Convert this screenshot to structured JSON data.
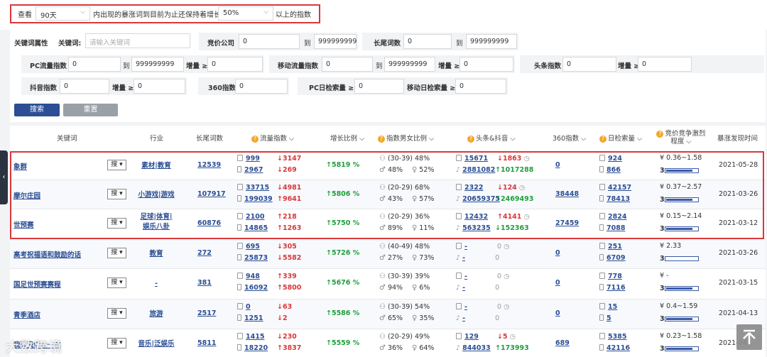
{
  "topbar": {
    "look_label": "查看",
    "period_value": "90天",
    "middle_text": "内出现的暴涨词到目前为止还保持着增长",
    "growth_value": "50%",
    "suffix_text": "以上的指数"
  },
  "filters": {
    "attr_label": "关键词属性",
    "keyword_label": "关键词:",
    "keyword_placeholder": "请输入关键词",
    "bid_company_label": "竞价公司",
    "longtail_label": "长尾词数",
    "pc_flow_label": "PC流量指数",
    "mobile_flow_label": "移动流量指数",
    "toutiao_label": "头条指数",
    "douyin_label": "抖音指数",
    "s360_label": "360指数",
    "pc_daily_label": "PC日检索量 ≥",
    "mobile_daily_label": "移动日检索量 ≥",
    "to": "到",
    "growth_ge": "增量 ≥",
    "zero": "0",
    "max": "999999999",
    "search_btn": "搜索",
    "reset_btn": "重置"
  },
  "table": {
    "headers": {
      "keyword": "关键词",
      "industry": "行业",
      "longtail": "长尾词数",
      "flow": "流量指数",
      "growth": "增长比例",
      "gender": "指数男女比例",
      "toutiao": "头条&抖音",
      "s360": "360指数",
      "daily": "日检索量",
      "bid": "竞价竞争激烈程度",
      "found": "暴涨发现时间"
    },
    "search_label": "搜",
    "rows": [
      {
        "kw": "象群",
        "industry": "素材|教育",
        "longtail": "12539",
        "pc": "999",
        "pc_d": "↓3147",
        "mob": "2967",
        "mob_d": "↓269",
        "growth": "↑5819 %",
        "age": "(30-39) 48%",
        "male": "48%",
        "female": "52%",
        "tt": "15671",
        "tt_d": "↓1863",
        "dy": "2881082",
        "dy_d": "↑1017288",
        "s360": "0",
        "daily_pc": "924",
        "daily_mob": "866",
        "bid_price": "¥ 0.36~1.58",
        "bid_level": "3",
        "bid_fill": 0.85,
        "date": "2021-05-28"
      },
      {
        "kw": "摩尔庄园",
        "industry": "小游戏|游戏",
        "longtail": "107917",
        "pc": "33715",
        "pc_d": "↓4981",
        "mob": "199039",
        "mob_d": "↑9641",
        "growth": "↑5806 %",
        "age": "(20-29) 68%",
        "male": "43%",
        "female": "57%",
        "tt": "2322",
        "tt_d": "↓124",
        "dy": "20659375",
        "dy_d": "↑2469493",
        "s360": "38448",
        "daily_pc": "42157",
        "daily_mob": "78413",
        "bid_price": "¥ 0.37~2.57",
        "bid_level": "3",
        "bid_fill": 0.85,
        "date": "2021-03-26"
      },
      {
        "kw": "世预赛",
        "industry": "足球|体育|",
        "industry2": "娱乐八卦",
        "longtail": "60876",
        "pc": "2100",
        "pc_d": "↑218",
        "mob": "14865",
        "mob_d": "↑1263",
        "growth": "↑5750 %",
        "age": "(20-29) 36%",
        "male": "89%",
        "female": "11%",
        "tt": "12432",
        "tt_d": "↑4141",
        "dy": "563235",
        "dy_d": "↓152363",
        "s360": "27459",
        "daily_pc": "2824",
        "daily_mob": "7088",
        "bid_price": "¥ 0.15~2.14",
        "bid_level": "3",
        "bid_fill": 0.85,
        "date": "2021-03-12"
      },
      {
        "kw": "高考祝福语和鼓励的话",
        "industry": "教育",
        "longtail": "272",
        "pc": "695",
        "pc_d": "↓305",
        "mob": "25873",
        "mob_d": "↓5582",
        "growth": "↑5726 %",
        "age": "(40-49) 48%",
        "male": "27%",
        "female": "73%",
        "tt": "-",
        "tt_d": "0",
        "dy": "-",
        "dy_d": "0",
        "s360": "0",
        "daily_pc": "251",
        "daily_mob": "6709",
        "bid_price": "¥ 2.33",
        "bid_level": "3",
        "bid_fill": 0.0,
        "date": "2021-03-26"
      },
      {
        "kw": "国足世预赛赛程",
        "industry": "-",
        "longtail": "381",
        "pc": "948",
        "pc_d": "↑339",
        "mob": "16092",
        "mob_d": "↑5800",
        "growth": "↑5676 %",
        "age": "(30-39) 39%",
        "male": "94%",
        "female": "6%",
        "tt": "-",
        "tt_d": "0",
        "dy": "-",
        "dy_d": "0",
        "s360": "0",
        "daily_pc": "778",
        "daily_mob": "7116",
        "bid_price": "¥ -",
        "bid_level": "3",
        "bid_fill": 0.85,
        "date": "2021-03-15"
      },
      {
        "kw": "青季酒店",
        "industry": "旅游",
        "longtail": "2517",
        "pc": "0",
        "pc_d": "↓63",
        "mob": "1251",
        "mob_d": "↓2",
        "growth": "↑5586 %",
        "age": "(30-39) 54%",
        "male": "65%",
        "female": "35%",
        "tt": "-",
        "tt_d": "0",
        "dy": "-",
        "dy_d": "0",
        "s360": "0",
        "daily_pc": "15",
        "daily_mob": "5",
        "bid_price": "¥ 0.4~1.59",
        "bid_level": "3",
        "bid_fill": 0.85,
        "date": "2021-04-13"
      },
      {
        "kw": "我要我们在一起",
        "industry": "音乐|泛娱乐",
        "longtail": "5811",
        "pc": "1415",
        "pc_d": "↓230",
        "mob": "18220",
        "mob_d": "↑3837",
        "growth": "↑5559 %",
        "age": "(20-29) 49%",
        "male": "36%",
        "female": "64%",
        "tt": "129",
        "tt_d": "↓5",
        "dy": "844033",
        "dy_d": "↑173993",
        "s360": "689",
        "daily_pc": "5385",
        "daily_mob": "42116",
        "bid_price": "¥ 0.23~1.58",
        "bid_level": "3",
        "bid_fill": 0.85,
        "date": "2021-04-"
      }
    ]
  },
  "watermark": "大数跨境",
  "colors": {
    "accent": "#2b4e94",
    "highlight": "#d9383a",
    "up": "#1e9e3a",
    "down": "#d9383a"
  },
  "icons": {
    "side_tab": "chevron-left-icon",
    "to_top": "arrow-up-icon"
  }
}
